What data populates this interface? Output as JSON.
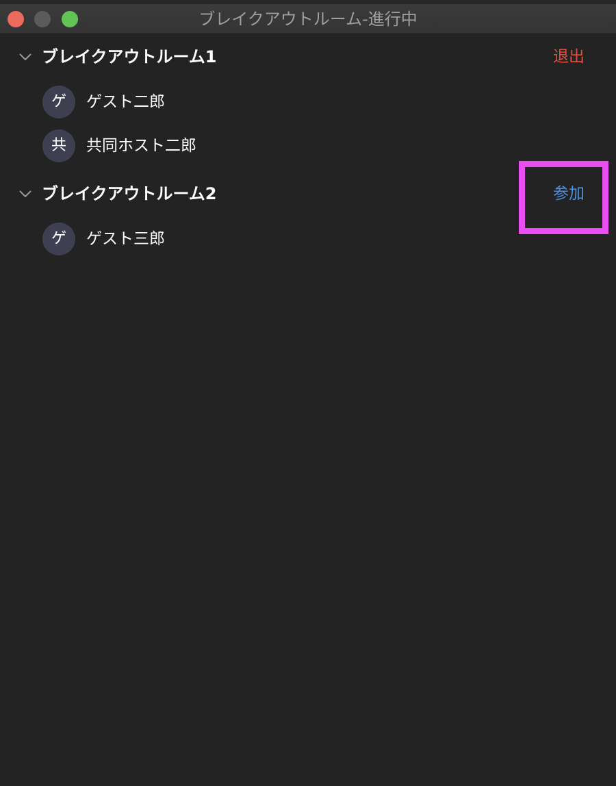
{
  "window": {
    "title": "ブレイクアウトルーム-進行中",
    "controls": [
      "close",
      "minimize",
      "zoom"
    ]
  },
  "rooms": [
    {
      "name": "ブレイクアウトルーム1",
      "action": "退出",
      "participants": [
        {
          "avatar": "ゲ",
          "name": "ゲスト二郎"
        },
        {
          "avatar": "共",
          "name": "共同ホスト二郎"
        }
      ]
    },
    {
      "name": "ブレイクアウトルーム2",
      "action": "参加",
      "participants": [
        {
          "avatar": "ゲ",
          "name": "ゲスト三郎"
        }
      ]
    }
  ],
  "colors": {
    "background": "#232323",
    "leave": "#e0503f",
    "join": "#4a90e2",
    "highlight": "#e84ef0",
    "avatar": "#3f3f52"
  }
}
